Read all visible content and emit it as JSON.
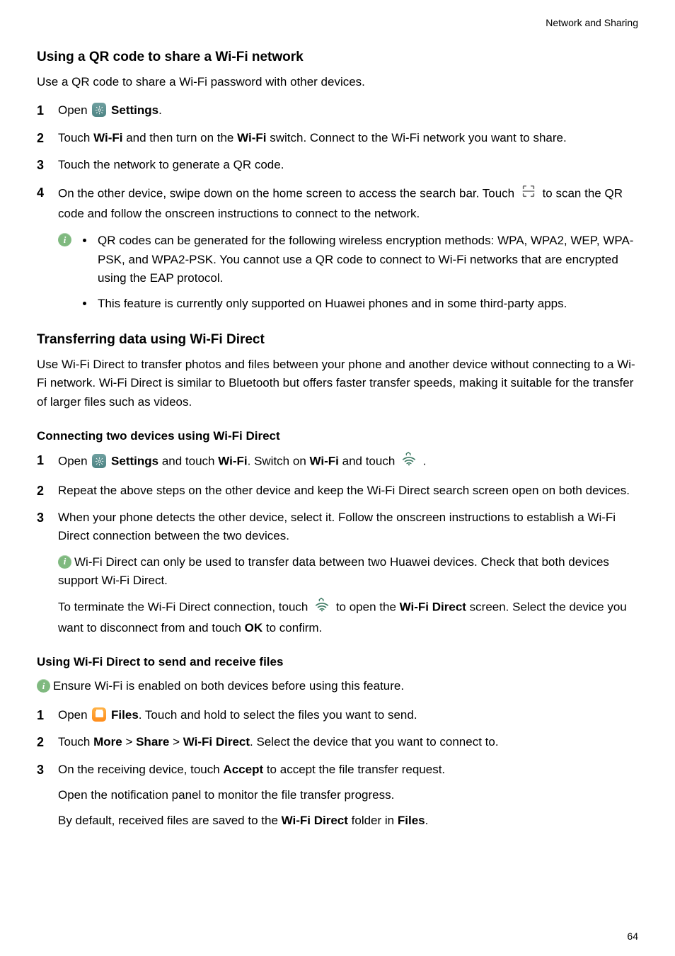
{
  "header": {
    "category": "Network and Sharing"
  },
  "pagenum": "64",
  "section1": {
    "title": "Using a QR code to share a Wi-Fi network",
    "intro": "Use a QR code to share a Wi-Fi password with other devices.",
    "steps": {
      "s1_open": "Open ",
      "s1_settings": "Settings",
      "s1_end": ".",
      "s2_a": "Touch ",
      "s2_wifi1": "Wi-Fi",
      "s2_b": " and then turn on the ",
      "s2_wifi2": "Wi-Fi",
      "s2_c": " switch. Connect to the Wi-Fi network you want to share.",
      "s3": "Touch the network to generate a QR code.",
      "s4_a": "On the other device, swipe down on the home screen to access the search bar. Touch ",
      "s4_b": " to scan the QR code and follow the onscreen instructions to connect to the network."
    },
    "info": {
      "b1": "QR codes can be generated for the following wireless encryption methods: WPA, WPA2, WEP, WPA-PSK, and WPA2-PSK. You cannot use a QR code to connect to Wi-Fi networks that are encrypted using the EAP protocol.",
      "b2": "This feature is currently only supported on Huawei phones and in some third-party apps."
    }
  },
  "section2": {
    "title": "Transferring data using Wi-Fi Direct",
    "intro": "Use Wi-Fi Direct to transfer photos and files between your phone and another device without connecting to a Wi-Fi network. Wi-Fi Direct is similar to Bluetooth but offers faster transfer speeds, making it suitable for the transfer of larger files such as videos.",
    "sub1": {
      "title": "Connecting two devices using Wi-Fi Direct",
      "s1_open": "Open ",
      "s1_settings": "Settings",
      "s1_b": " and touch ",
      "s1_wifi1": "Wi-Fi",
      "s1_c": ". Switch on ",
      "s1_wifi2": "Wi-Fi",
      "s1_d": " and touch ",
      "s1_end": ".",
      "s2": "Repeat the above steps on the other device and keep the Wi-Fi Direct search screen open on both devices.",
      "s3": "When your phone detects the other device, select it. Follow the onscreen instructions to establish a Wi-Fi Direct connection between the two devices.",
      "info": "Wi-Fi Direct can only be used to transfer data between two Huawei devices. Check that both devices support Wi-Fi Direct.",
      "term_a": "To terminate the Wi-Fi Direct connection, touch ",
      "term_b": " to open the ",
      "term_wfd": "Wi-Fi Direct",
      "term_c": " screen. Select the device you want to disconnect from and touch ",
      "term_ok": "OK",
      "term_d": " to confirm."
    },
    "sub2": {
      "title": "Using Wi-Fi Direct to send and receive files",
      "info": "Ensure Wi-Fi is enabled on both devices before using this feature.",
      "s1_open": "Open ",
      "s1_files": "Files",
      "s1_b": ". Touch and hold to select the files you want to send.",
      "s2_a": "Touch ",
      "s2_more": "More",
      "s2_gt1": " > ",
      "s2_share": "Share",
      "s2_gt2": " > ",
      "s2_wfd": "Wi-Fi Direct",
      "s2_b": ". Select the device that you want to connect to.",
      "s3_a": "On the receiving device, touch ",
      "s3_accept": "Accept",
      "s3_b": " to accept the file transfer request.",
      "s3_p2": "Open the notification panel to monitor the file transfer progress.",
      "s3_p3_a": "By default, received files are saved to the ",
      "s3_p3_wfd": "Wi-Fi Direct",
      "s3_p3_b": " folder in ",
      "s3_p3_files": "Files",
      "s3_p3_c": "."
    }
  }
}
